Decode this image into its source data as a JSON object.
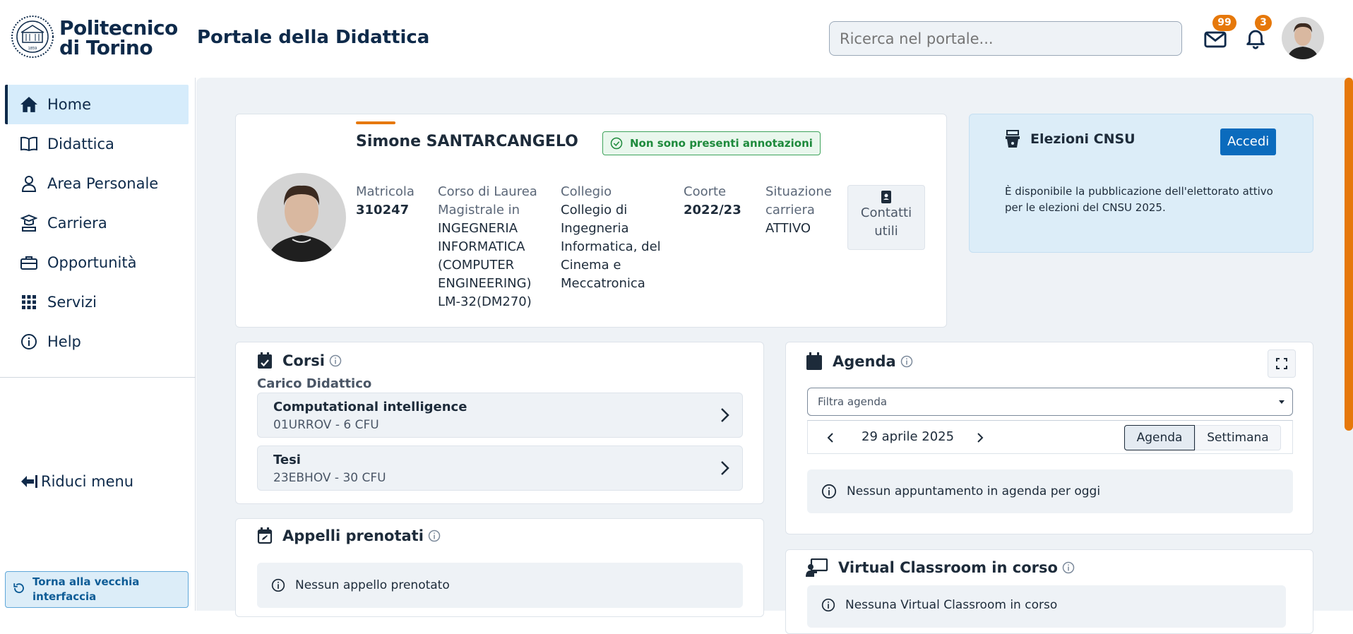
{
  "header": {
    "brand_line1": "Politecnico",
    "brand_line2": "di Torino",
    "title": "Portale della Didattica",
    "search_placeholder": "Ricerca nel portale...",
    "mail_count": "99",
    "notif_count": "3",
    "icons": [
      "mail-icon",
      "bell-icon"
    ]
  },
  "sidebar": {
    "items": [
      {
        "label": "Home",
        "icon": "home-icon"
      },
      {
        "label": "Didattica",
        "icon": "book-icon"
      },
      {
        "label": "Area Personale",
        "icon": "user-icon"
      },
      {
        "label": "Carriera",
        "icon": "graduation-icon"
      },
      {
        "label": "Opportunità",
        "icon": "briefcase-icon"
      },
      {
        "label": "Servizi",
        "icon": "grid-icon"
      },
      {
        "label": "Help",
        "icon": "info-icon"
      }
    ],
    "reduce_label": "Riduci menu",
    "old_ui_label": "Torna alla vecchia interfaccia"
  },
  "profile": {
    "name": "Simone SANTARCANGELO",
    "annotation_badge": "Non sono presenti annotazioni",
    "matricola_label": "Matricola",
    "matricola": "310247",
    "corso_label_1": "Corso di Laurea",
    "corso_label_2": "Magistrale in",
    "corso_lines": [
      "INGEGNERIA",
      "INFORMATICA",
      "(COMPUTER",
      "ENGINEERING)",
      "LM-32(DM270)"
    ],
    "collegio_label": "Collegio",
    "collegio_lines": [
      "Collegio di",
      "Ingegneria",
      "Informatica, del",
      "Cinema e",
      "Meccatronica"
    ],
    "coorte_label": "Coorte",
    "coorte": "2022/23",
    "situazione_label_1": "Situazione",
    "situazione_label_2": "carriera",
    "situazione": "ATTIVO",
    "contatti_line1": "Contatti",
    "contatti_line2": "utili"
  },
  "elezioni": {
    "title": "Elezioni CNSU",
    "button": "Accedi",
    "text_line1": "È disponibile la pubblicazione dell'elettorato attivo",
    "text_line2": "per le elezioni del CNSU 2025."
  },
  "corsi": {
    "title": "Corsi",
    "subtitle": "Carico Didattico",
    "items": [
      {
        "name": "Computational intelligence",
        "detail": "01URROV - 6 CFU"
      },
      {
        "name": "Tesi",
        "detail": "23EBHOV - 30 CFU"
      }
    ]
  },
  "appelli": {
    "title": "Appelli prenotati",
    "empty": "Nessun appello prenotato"
  },
  "agenda": {
    "title": "Agenda",
    "filter_placeholder": "Filtra agenda",
    "date": "29 aprile 2025",
    "view_agenda": "Agenda",
    "view_week": "Settimana",
    "empty": "Nessun appuntamento in agenda per oggi"
  },
  "virtual": {
    "title": "Virtual Classroom in corso",
    "empty": "Nessuna Virtual Classroom in corso"
  },
  "colors": {
    "brand": "#0e2a4a",
    "accent": "#e6780a",
    "primary_button": "#0b6bbd",
    "success": "#1e8a3c"
  }
}
